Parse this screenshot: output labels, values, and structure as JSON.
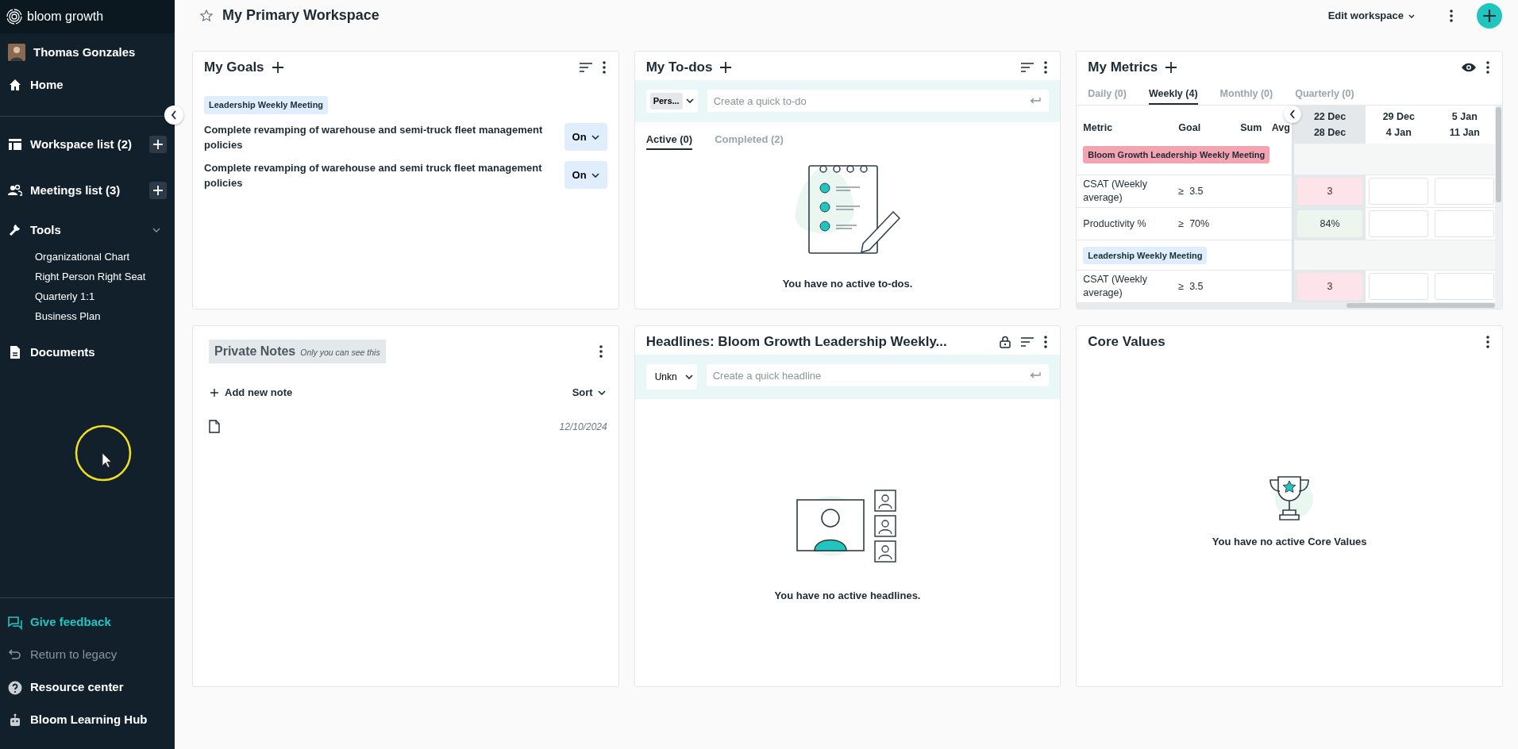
{
  "sidebar": {
    "brand": "bloom growth",
    "user": "Thomas Gonzales",
    "items": [
      {
        "kind": "link",
        "label": "Home"
      },
      {
        "kind": "section",
        "label": "Workspace list (2)"
      },
      {
        "kind": "section",
        "label": "Meetings list (3)"
      },
      {
        "kind": "group",
        "label": "Tools",
        "expanded": true,
        "children": [
          {
            "label": "Organizational Chart"
          },
          {
            "label": "Right Person Right Seat"
          },
          {
            "label": "Quarterly 1:1"
          },
          {
            "label": "Business Plan"
          }
        ]
      },
      {
        "kind": "link",
        "label": "Documents"
      }
    ],
    "footer": [
      {
        "kind": "accent",
        "label": "Give feedback"
      },
      {
        "kind": "muted",
        "label": "Return to legacy"
      },
      {
        "kind": "normal",
        "label": "Resource center"
      },
      {
        "kind": "normal",
        "label": "Bloom Learning Hub"
      }
    ]
  },
  "header": {
    "title": "My Primary Workspace",
    "starred": false,
    "edit_label": "Edit workspace"
  },
  "goals": {
    "title": "My Goals",
    "tag": "Leadership Weekly Meeting",
    "items": [
      {
        "text": "Complete revamping of warehouse and semi-truck fleet management policies",
        "status": "On"
      },
      {
        "text": "Complete revamping of warehouse and semi truck fleet management policies",
        "status": "On"
      }
    ]
  },
  "todos": {
    "title": "My To-dos",
    "owner": "Pers...",
    "placeholder": "Create a quick to-do",
    "tabs": [
      {
        "label": "Active (0)",
        "selected": true
      },
      {
        "label": "Completed (2)",
        "selected": false
      }
    ],
    "empty_text": "You have no active to-dos."
  },
  "metrics": {
    "title": "My Metrics",
    "tabs": [
      {
        "label": "Daily (0)",
        "selected": false
      },
      {
        "label": "Weekly (4)",
        "selected": true
      },
      {
        "label": "Monthly (0)",
        "selected": false
      },
      {
        "label": "Quarterly (0)",
        "selected": false
      }
    ],
    "columns": [
      "Metric",
      "Goal",
      "Sum",
      "Avg"
    ],
    "weeks": [
      {
        "start": "22 Dec",
        "end": "28 Dec",
        "selected": true
      },
      {
        "start": "29 Dec",
        "end": "4 Jan",
        "selected": false
      },
      {
        "start": "5 Jan",
        "end": "11 Jan",
        "selected": false
      }
    ],
    "groups": [
      {
        "label": "Bloom Growth Leadership Weekly Meeting",
        "color": "#f4a3b1",
        "rows": [
          {
            "metric": "CSAT (Weekly average)",
            "goal": "≥  3.5",
            "values": [
              {
                "kind": "miss",
                "text": "3"
              },
              {
                "kind": "empty"
              },
              {
                "kind": "empty"
              }
            ]
          },
          {
            "metric": "Productivity %",
            "goal": "≥  70%",
            "values": [
              {
                "kind": "hit",
                "text": "84%"
              },
              {
                "kind": "empty"
              },
              {
                "kind": "empty"
              }
            ]
          }
        ]
      },
      {
        "label": "Leadership Weekly Meeting",
        "color": "#e0edfc",
        "rows": [
          {
            "metric": "CSAT (Weekly average)",
            "goal": "≥  3.5",
            "values": [
              {
                "kind": "miss",
                "text": "3"
              },
              {
                "kind": "empty"
              },
              {
                "kind": "empty"
              }
            ]
          }
        ]
      }
    ]
  },
  "notes": {
    "title": "Private Notes",
    "subtitle": "Only you can see this",
    "add_label": "Add new note",
    "sort_label": "Sort",
    "items": [
      {
        "date": "12/10/2024"
      }
    ]
  },
  "headlines": {
    "title": "Headlines: Bloom Growth Leadership Weekly...",
    "owner": "Unkn",
    "placeholder": "Create a quick headline",
    "empty_text": "You have no active headlines."
  },
  "core_values": {
    "title": "Core Values",
    "empty_text": "You have no active Core Values"
  }
}
